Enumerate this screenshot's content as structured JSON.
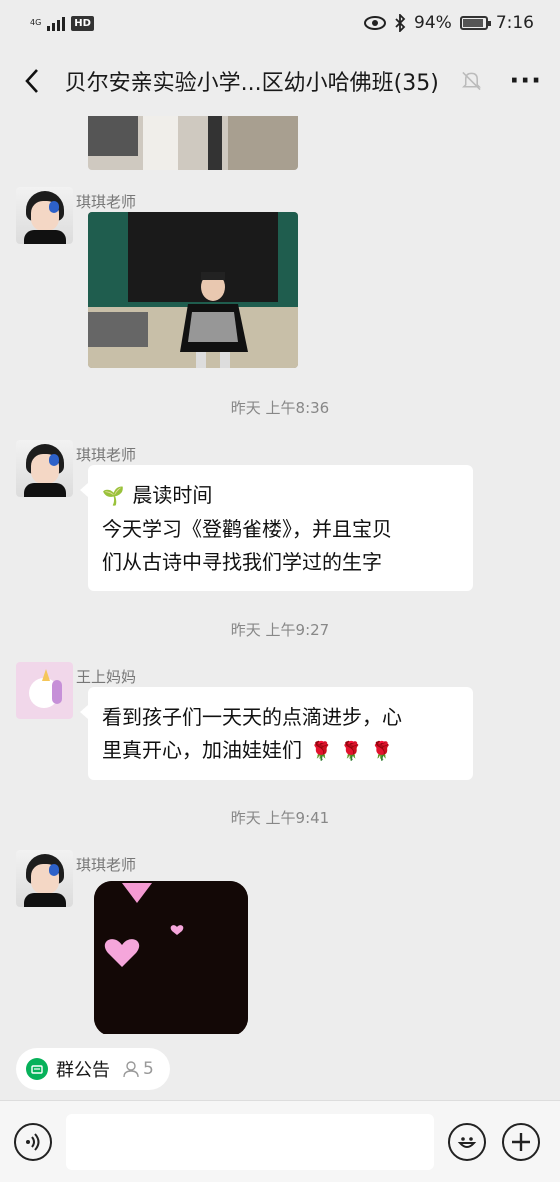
{
  "status_bar": {
    "network_label": "4G",
    "hd_label": "HD",
    "battery": "94%",
    "time": "7:16"
  },
  "header": {
    "title": "贝尔安亲实验小学...区幼小哈佛班(35)"
  },
  "messages": [
    {
      "sender": "琪琪老师",
      "type": "image"
    },
    {
      "timestamp": "昨天 上午8:36"
    },
    {
      "sender": "琪琪老师",
      "line1": "晨读时间",
      "line2": "今天学习《登鹳雀楼》，并且宝贝",
      "line3": "们从古诗中寻找我们学过的生字"
    },
    {
      "timestamp": "昨天 上午9:27"
    },
    {
      "sender": "王上妈妈",
      "line1": "看到孩子们一天天的点滴进步，心",
      "line2": "里真开心，加油娃娃们"
    },
    {
      "timestamp": "昨天 上午9:41"
    },
    {
      "sender": "琪琪老师",
      "type": "sticker"
    }
  ],
  "bottom": {
    "announcement_label": "群公告",
    "member_count": "5"
  },
  "icons": [
    "back-icon",
    "mute-icon",
    "more-icon",
    "voice-icon",
    "emoji-icon",
    "plus-icon",
    "announcement-icon",
    "person-icon"
  ]
}
